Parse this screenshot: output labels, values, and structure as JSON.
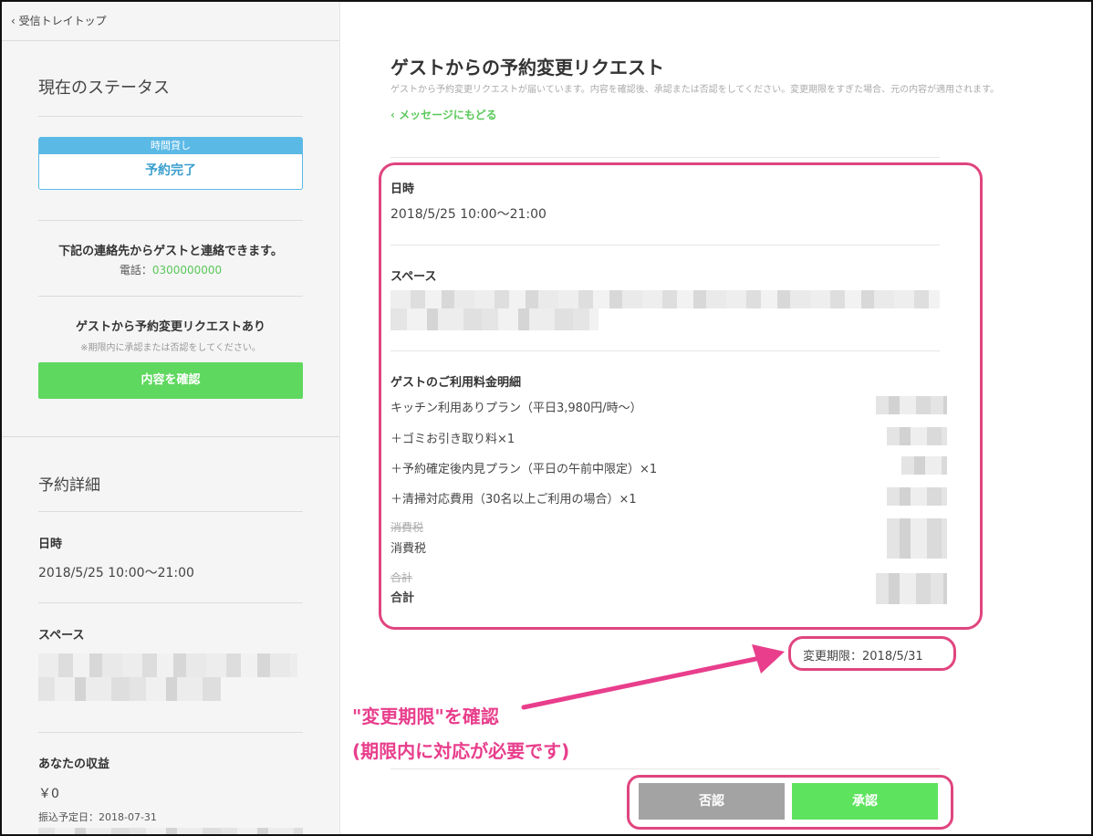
{
  "sidebar": {
    "back_label": "受信トレイトップ",
    "status_heading": "現在のステータス",
    "status_tag": "時間貸し",
    "status_text": "予約完了",
    "contact_title": "下記の連絡先からゲストと連絡できます。",
    "phone_label": "電話：",
    "phone_number": "0300000000",
    "request_title": "ゲストから予約変更リクエストあり",
    "request_note": "※期限内に承認または否認をしてください。",
    "confirm_button": "内容を確認",
    "details_heading": "予約詳細",
    "datetime_label": "日時",
    "datetime_value": "2018/5/25 10:00〜21:00",
    "space_label": "スペース",
    "earnings_label": "あなたの収益",
    "earnings_value": "￥0",
    "transfer_date": "振込予定日：2018-07-31"
  },
  "main": {
    "title": "ゲストからの予約変更リクエスト",
    "subtitle": "ゲストから予約変更リクエストが届いています。内容を確認後、承認または否認をしてください。変更期限をすぎた場合、元の内容が適用されます。",
    "back_to_messages": "メッセージにもどる",
    "datetime_label": "日時",
    "datetime_value": "2018/5/25 10:00〜21:00",
    "space_label": "スペース",
    "fees_label": "ゲストのご利用料金明細",
    "fee_items": [
      "キッチン利用ありプラン（平日3,980円/時〜）",
      "＋ゴミお引き取り料×1",
      "＋予約確定後内見プラン（平日の午前中限定）×1",
      "＋清掃対応費用（30名以上ご利用の場合）×1"
    ],
    "tax_old_label": "消費税",
    "tax_label": "消費税",
    "total_old_label": "合計",
    "total_label": "合計",
    "deadline": "変更期限：2018/5/31",
    "reject_button": "否認",
    "approve_button": "承認"
  },
  "annotation": {
    "line1": "\"変更期限\"を確認",
    "line2": "(期限内に対応が必要です)",
    "color": "#e83e8c"
  },
  "colors": {
    "accent_green": "#5ed85e",
    "status_blue": "#5bb9e6",
    "highlight_pink": "#e0457f",
    "reject_gray": "#a3a3a3"
  }
}
